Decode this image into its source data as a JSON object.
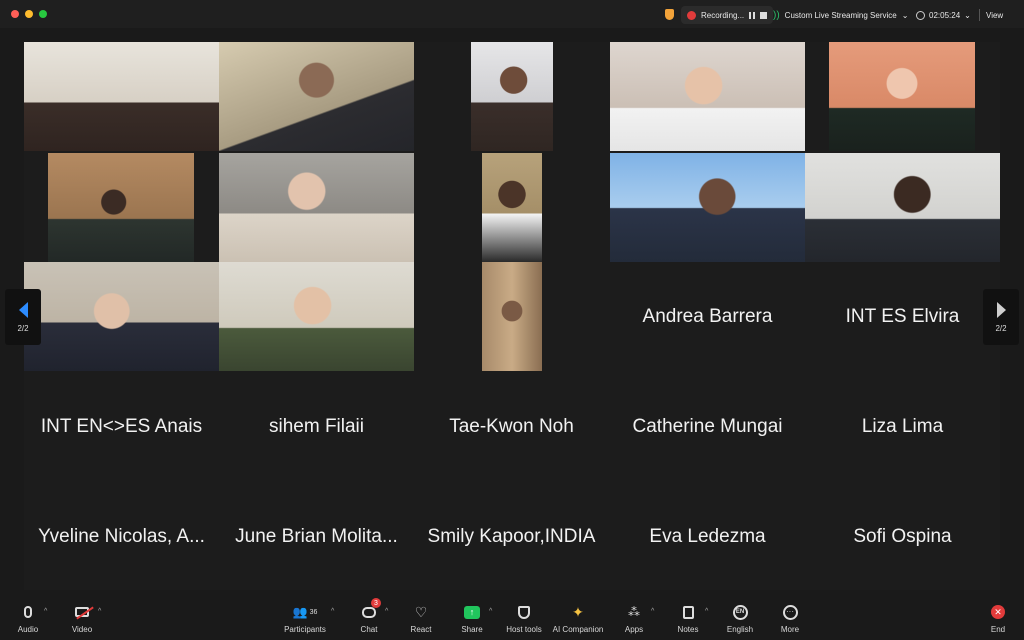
{
  "titlebar": {
    "recording_label": "Recording...",
    "stream_label": "Custom Live Streaming Service",
    "timer": "02:05:24",
    "view_label": "View"
  },
  "pager": {
    "left_label": "2/2",
    "right_label": "2/2"
  },
  "name_tiles": [
    "Andrea Barrera",
    "INT ES Elvira",
    "INT EN<>ES Anais",
    "sihem Filaii",
    "Tae-Kwon Noh",
    "Catherine Mungai",
    "Liza Lima",
    "Yveline Nicolas, A...",
    "June Brian Molita...",
    "Smily Kapoor,INDIA",
    "Eva Ledezma",
    "Sofi Ospina"
  ],
  "toolbar": {
    "audio": "Audio",
    "video": "Video",
    "participants": "Participants",
    "participants_count": "36",
    "chat": "Chat",
    "chat_badge": "3",
    "react": "React",
    "share": "Share",
    "host_tools": "Host tools",
    "ai_companion": "AI Companion",
    "apps": "Apps",
    "notes": "Notes",
    "language": "English",
    "language_code": "EN",
    "more": "More",
    "end": "End"
  },
  "colors": {
    "accent_blue": "#2d8cff",
    "end_red": "#e23b3b",
    "share_green": "#21c55d"
  }
}
